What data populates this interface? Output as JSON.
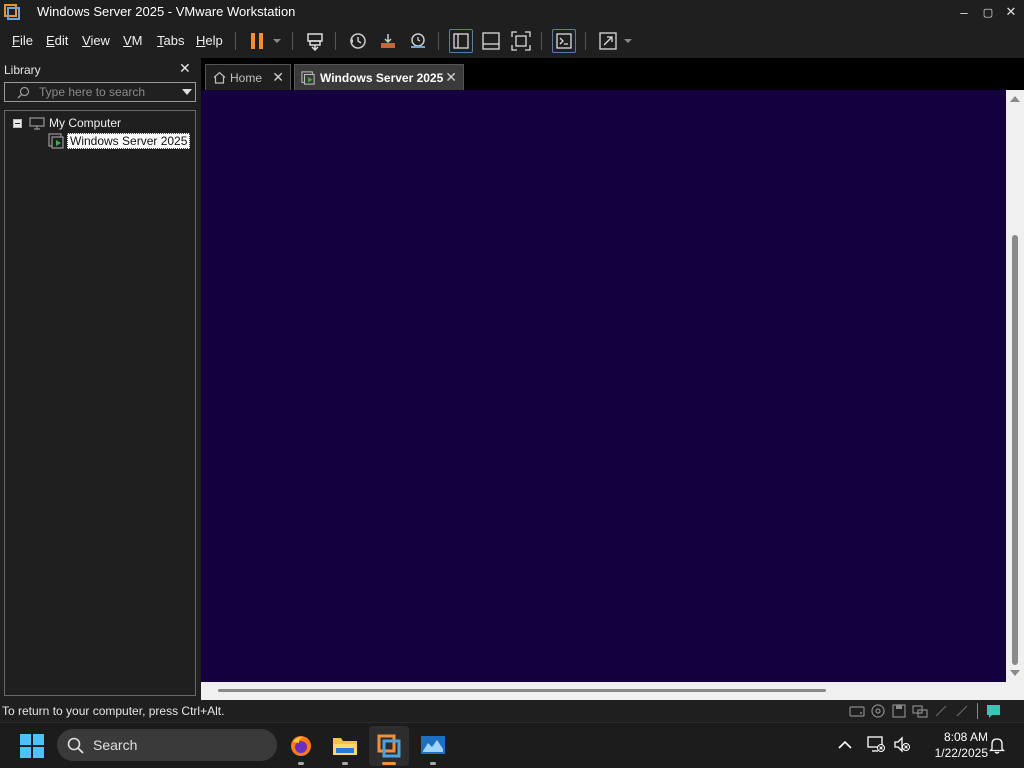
{
  "window": {
    "title": "Windows Server 2025 - VMware Workstation",
    "minimize": "–",
    "maximize": "▢",
    "close": "✕"
  },
  "menu": {
    "items": [
      {
        "label_ul": "F",
        "label_rest": "ile"
      },
      {
        "label_ul": "E",
        "label_rest": "dit"
      },
      {
        "label_ul": "V",
        "label_rest": "iew"
      },
      {
        "label_ul": "V",
        "label_rest": "M"
      },
      {
        "label_ul": "T",
        "label_rest": "abs"
      },
      {
        "label_ul": "H",
        "label_rest": "elp"
      }
    ]
  },
  "library": {
    "title": "Library",
    "close": "✕",
    "search_placeholder": "Type here to search",
    "tree": {
      "root_label": "My Computer",
      "child_label": "Windows Server 2025"
    }
  },
  "tabs": [
    {
      "label": "Home",
      "close": "✕"
    },
    {
      "label": "Windows Server 2025",
      "close": "✕"
    }
  ],
  "status": {
    "message": "To return to your computer, press Ctrl+Alt."
  },
  "taskbar": {
    "search_label": "Search",
    "time": "8:08 AM",
    "date": "1/22/2025"
  },
  "colors": {
    "vm_screen": "#14003f",
    "accent_pause": "#f28f3b",
    "chrome_bg": "#1f1f1f"
  }
}
